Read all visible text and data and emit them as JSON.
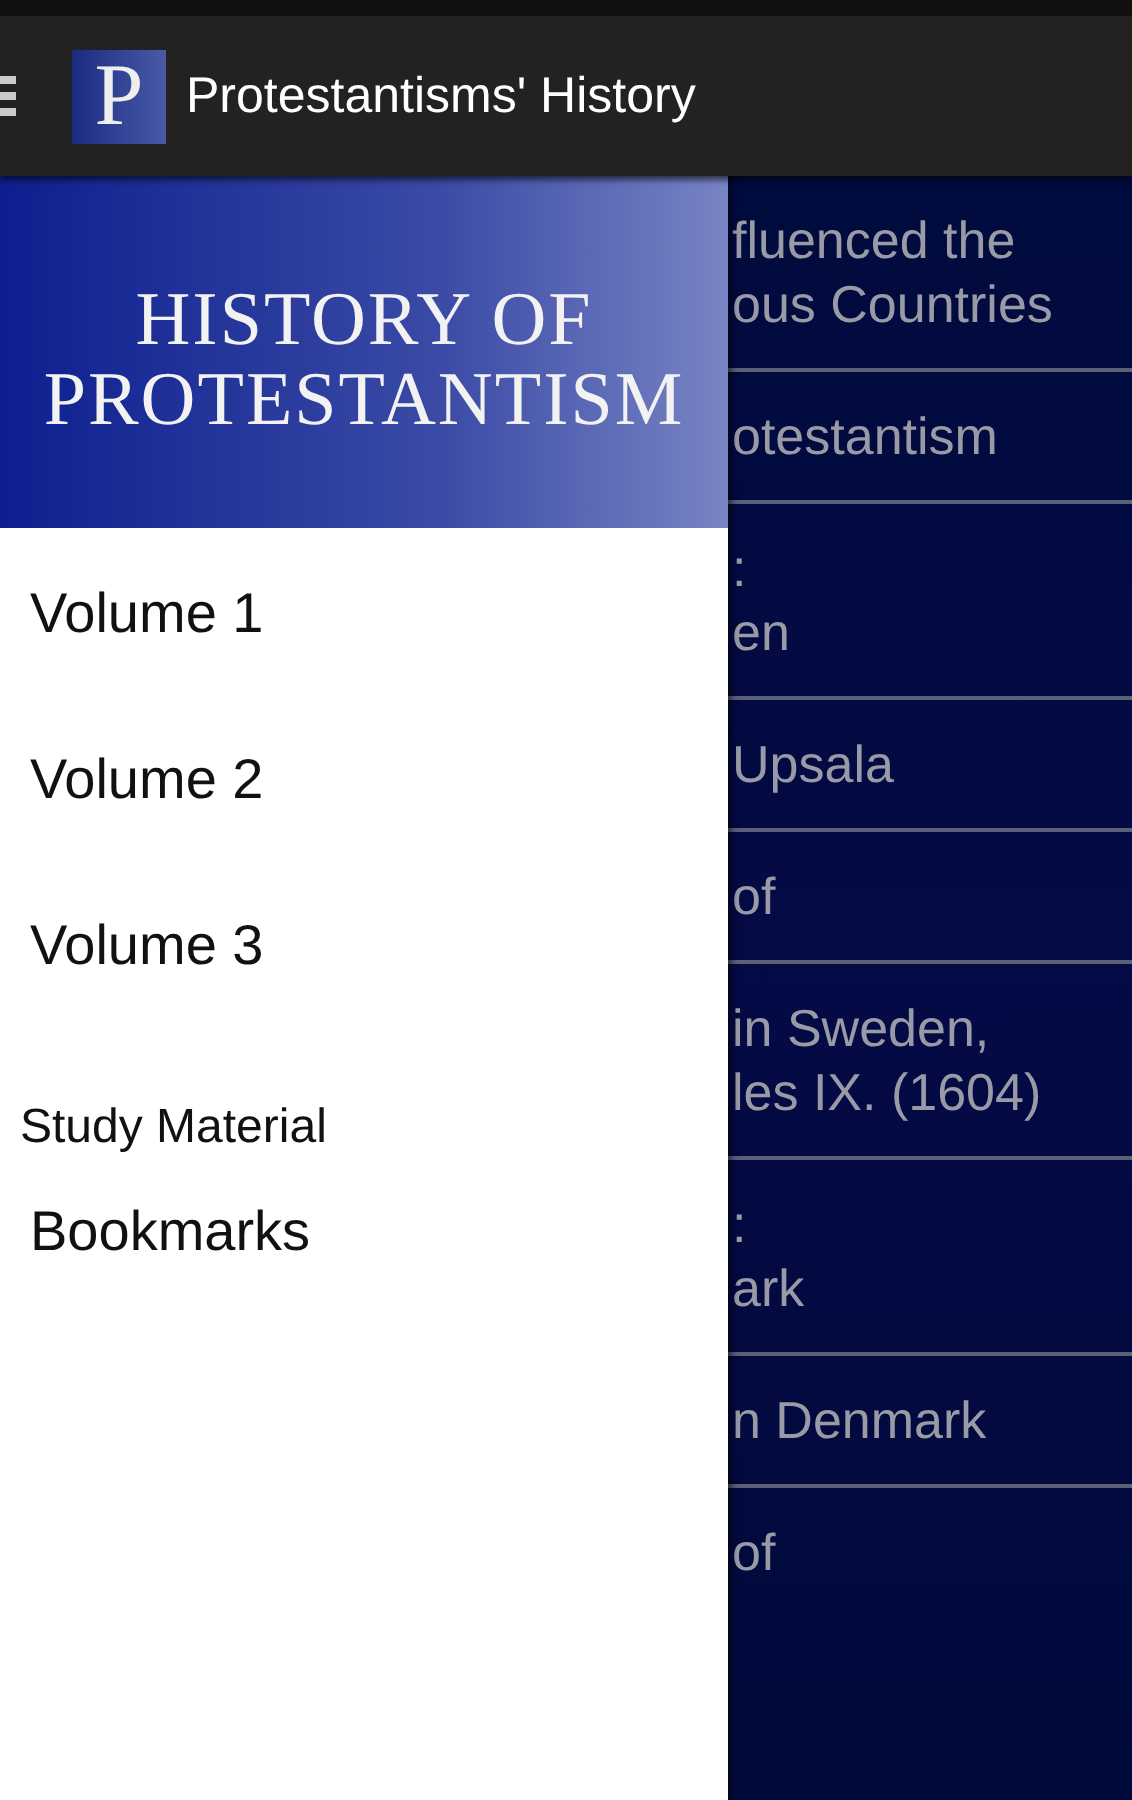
{
  "action_bar": {
    "title": "Protestantisms' History",
    "logo_letter": "P"
  },
  "drawer": {
    "header_lines": [
      "HISTORY OF",
      "PROTESTANTISM"
    ],
    "items": [
      {
        "label": "Volume 1",
        "kind": "large"
      },
      {
        "label": "Volume 2",
        "kind": "large"
      },
      {
        "label": "Volume 3",
        "kind": "large"
      },
      {
        "label": "Study Material",
        "kind": "small"
      },
      {
        "label": "Bookmarks",
        "kind": "large"
      }
    ]
  },
  "content_list": [
    {
      "lines": [
        "fluenced the",
        "ous Countries"
      ]
    },
    {
      "lines": [
        "otestantism"
      ]
    },
    {
      "lines": [
        ":",
        "en"
      ]
    },
    {
      "lines": [
        "Upsala"
      ]
    },
    {
      "lines": [
        "of"
      ]
    },
    {
      "lines": [
        "in Sweden,",
        "les IX. (1604)"
      ]
    },
    {
      "lines": [
        ":",
        "ark"
      ]
    },
    {
      "lines": [
        "n Denmark"
      ]
    },
    {
      "lines": [
        "of"
      ]
    }
  ]
}
